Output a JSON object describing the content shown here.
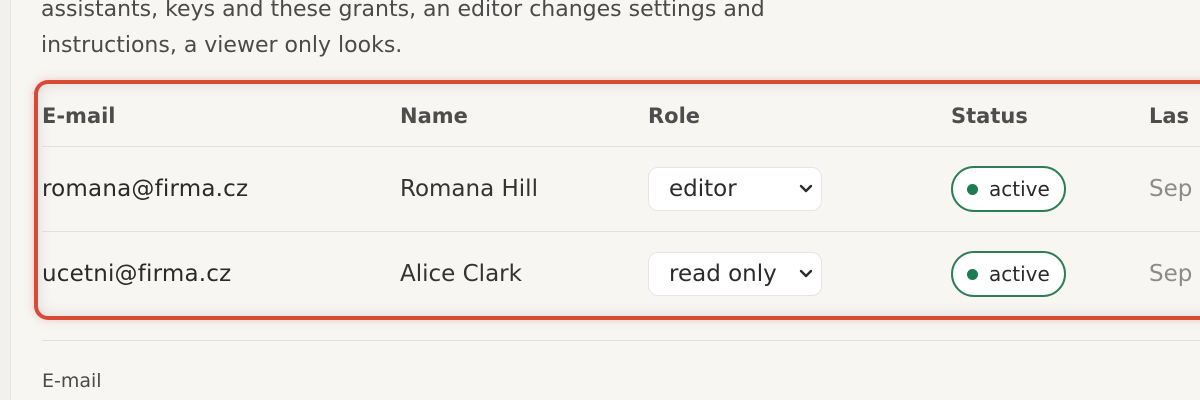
{
  "intro": {
    "line1": "assistants, keys and these grants, an editor changes settings and",
    "line2": "instructions, a viewer only looks."
  },
  "table": {
    "columns": {
      "email": "E-mail",
      "name": "Name",
      "role": "Role",
      "status": "Status",
      "last": "Las"
    },
    "rows": [
      {
        "email": "romana@firma.cz",
        "name": "Romana Hill",
        "role": "editor",
        "status": "active",
        "last": "Sep"
      },
      {
        "email": "ucetni@firma.cz",
        "name": "Alice Clark",
        "role": "read only",
        "status": "active",
        "last": "Sep"
      }
    ]
  },
  "form": {
    "email_label": "E-mail"
  },
  "colors": {
    "highlight_border": "#d84a36",
    "status_active": "#1e7b50",
    "status_border": "#2f7d57"
  },
  "icons": {
    "role_dropdown": "chevron-down-icon",
    "status_indicator": "status-dot"
  }
}
